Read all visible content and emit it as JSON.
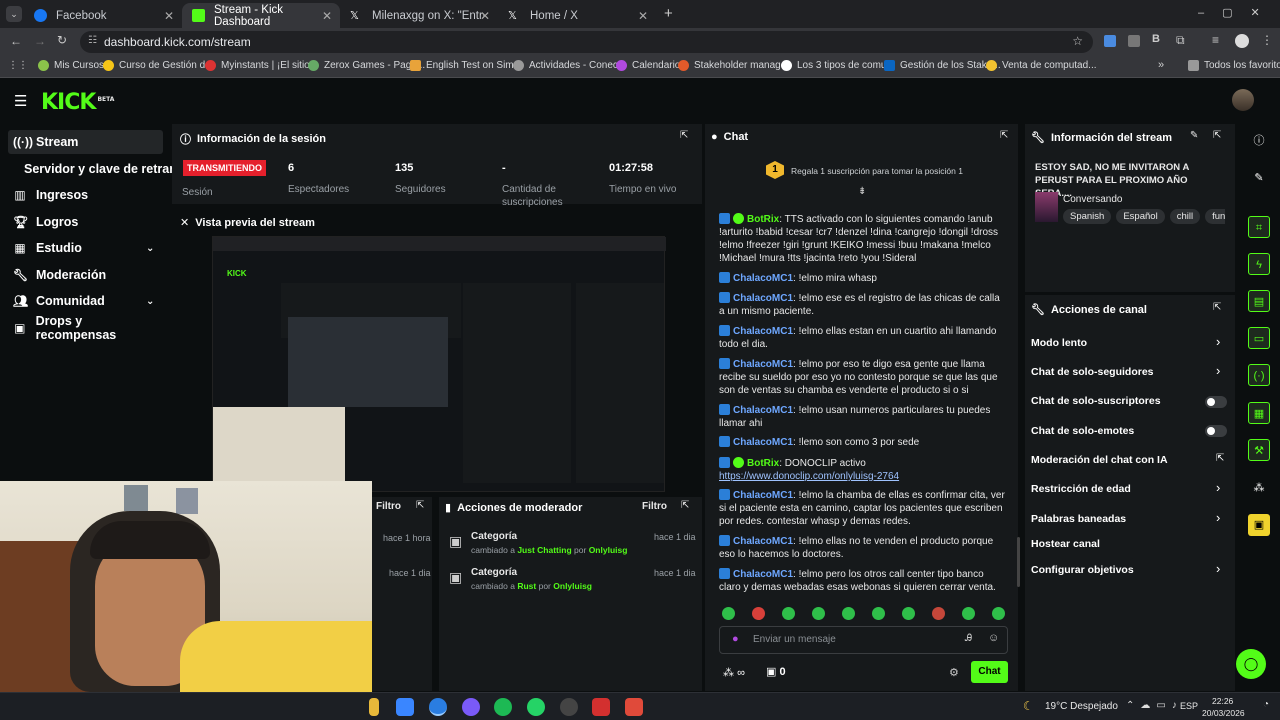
{
  "browser": {
    "tabs": [
      {
        "title": "Facebook",
        "color": "#1877f2"
      },
      {
        "title": "Stream - Kick Dashboard",
        "color": "#53fc18"
      },
      {
        "title": "Milenaxgg on X: \"Entrevista al",
        "color": "#000000"
      },
      {
        "title": "Home / X",
        "color": "#000000"
      }
    ],
    "url": "dashboard.kick.com/stream",
    "bookmarks": [
      "Mis Cursos",
      "Curso de Gestión d...",
      "Myinstants | ¡El sitio...",
      "Zerox Games - Paga...",
      "English Test on Sim...",
      "Actividades - Conec...",
      "Calendario",
      "Stakeholder manag...",
      "Los 3 tipos de comu...",
      "Gestión de los Stake...",
      "Venta de computad...",
      "Todos los favoritos"
    ]
  },
  "app": {
    "logo": "KICK",
    "logo_badge": "BETA",
    "sidebar": {
      "items": [
        {
          "label": "Stream",
          "icon": "signal-icon"
        },
        {
          "label": "Servidor y clave de retransm",
          "icon": ""
        },
        {
          "label": "Ingresos",
          "icon": "bank-icon"
        },
        {
          "label": "Logros",
          "icon": "trophy-icon"
        },
        {
          "label": "Estudio",
          "icon": "studio-icon"
        },
        {
          "label": "Moderación",
          "icon": "wrench-icon"
        },
        {
          "label": "Comunidad",
          "icon": "people-icon"
        },
        {
          "label": "Drops y recompensas",
          "icon": "gift-icon"
        }
      ]
    },
    "session": {
      "title": "Información de la sesión",
      "status": "TRANSMITIENDO",
      "status_label": "Sesión",
      "stats": [
        {
          "value": "6",
          "label": "Espectadores"
        },
        {
          "value": "135",
          "label": "Seguidores"
        },
        {
          "value": "-",
          "label": "Cantidad de suscripciones"
        },
        {
          "value": "01:27:58",
          "label": "Tiempo en vivo"
        }
      ]
    },
    "preview": {
      "title": "Vista previa del stream"
    },
    "mod_actions": {
      "title": "Acciones de moderador",
      "filter": "Filtro",
      "left_filter": "Filtro",
      "left_times": [
        "hace 1 hora",
        "hace 1 dia"
      ],
      "entries": [
        {
          "category": "Categoría",
          "prefix": "cambiado a",
          "value": "Just Chatting",
          "by": "por",
          "user": "Onlyluisg",
          "time": "hace 1 dia"
        },
        {
          "category": "Categoría",
          "prefix": "cambiado a",
          "value": "Rust",
          "by": "por",
          "user": "Onlyluisg",
          "time": "hace 1 dia"
        }
      ]
    },
    "chat": {
      "title": "Chat",
      "sub_goal": "Regala 1 suscripción para tomar la posición 1",
      "sub_goal_rank": "1",
      "messages": [
        {
          "user": "BotRix",
          "bot": true,
          "text": "TTS activado con lo siguientes comando !anub !arturito !babid !cesar !cr7 !denzel !dina !cangrejo !dongil !dross !elmo !freezer !giri !grunt !KEIKO !messi !buu !makana !melco !Michael !mura !tts !jacinta !reto !you !Sideral"
        },
        {
          "user": "ChalacoMC1",
          "text": "!elmo mira whasp"
        },
        {
          "user": "ChalacoMC1",
          "text": "!elmo ese es el registro de las chicas de calla a un mismo paciente."
        },
        {
          "user": "ChalacoMC1",
          "text": "!elmo ellas estan en un cuartito ahi llamando todo el dia."
        },
        {
          "user": "ChalacoMC1",
          "text": "!elmo por eso te digo esa gente que llama recibe su sueldo por eso yo no contesto porque se que las que son de ventas su chamba es venderte el producto si o si"
        },
        {
          "user": "ChalacoMC1",
          "text": "!elmo usan numeros particulares tu puedes llamar ahi"
        },
        {
          "user": "ChalacoMC1",
          "text": "!lemo son como 3 por sede"
        },
        {
          "user": "BotRix",
          "bot": true,
          "text": "DONOCLIP activo",
          "link": "https://www.donoclip.com/onlyluisg-2764"
        },
        {
          "user": "ChalacoMC1",
          "text": "!elmo la chamba de ellas es confirmar cita, ver si el paciente esta en camino, captar los pacientes que escriben por redes. contestar whasp y demas redes."
        },
        {
          "user": "ChalacoMC1",
          "text": "!elmo ellas no te venden el producto porque eso lo hacemos lo doctores."
        },
        {
          "user": "ChalacoMC1",
          "text": "!elmo pero los otros call center tipo banco claro y demas webadas esas webonas si quieren cerrar venta."
        }
      ],
      "input_placeholder": "Enviar un mensaje",
      "points": "∞",
      "gift_count": "0",
      "send_label": "Chat"
    },
    "stream_info": {
      "title": "Información del stream",
      "stream_title": "ESTOY SAD, NO ME INVITARON A PERUST PARA EL PROXIMO AÑO SERA....",
      "category": "Conversando",
      "tags": [
        "Spanish",
        "Español",
        "chill",
        "funn"
      ]
    },
    "channel_actions": {
      "title": "Acciones de canal",
      "items": [
        {
          "label": "Modo lento",
          "control": "arrow"
        },
        {
          "label": "Chat de solo-seguidores",
          "control": "arrow"
        },
        {
          "label": "Chat de solo-suscriptores",
          "control": "toggle"
        },
        {
          "label": "Chat de solo-emotes",
          "control": "toggle"
        },
        {
          "label": "Moderación del chat con IA",
          "control": "external"
        },
        {
          "label": "Restricción de edad",
          "control": "arrow"
        },
        {
          "label": "Palabras baneadas",
          "control": "arrow"
        },
        {
          "label": "Hostear canal",
          "control": "none"
        },
        {
          "label": "Configurar objetivos",
          "control": "arrow"
        }
      ]
    }
  },
  "taskbar": {
    "weather": "19°C Despejado",
    "lang": "ESP",
    "time": "22:26",
    "date": "20/03/2026"
  },
  "colors": {
    "accent": "#53fc18",
    "live": "#e5202c",
    "chat_user": "#6ea7ff"
  }
}
